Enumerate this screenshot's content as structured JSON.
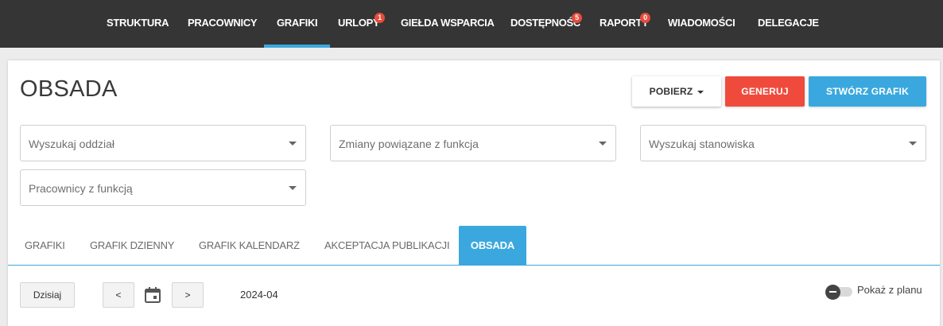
{
  "nav": {
    "items": [
      {
        "label": "STRUKTURA"
      },
      {
        "label": "PRACOWNICY"
      },
      {
        "label": "GRAFIKI",
        "active": true
      },
      {
        "label": "URLOPY",
        "badge": "1"
      },
      {
        "label": "GIEŁDA WSPARCIA"
      },
      {
        "label": "DOSTĘPNOŚĆ",
        "badge": "5"
      },
      {
        "label": "RAPORTY",
        "badge": "0"
      },
      {
        "label": "WIADOMOŚCI"
      },
      {
        "label": "DELEGACJE"
      }
    ],
    "active_color": "#3aa8de",
    "badge_color": "#e84b3c"
  },
  "page": {
    "title": "OBSADA"
  },
  "actions": {
    "pobierz": "POBIERZ",
    "generuj": "GENERUJ",
    "stworz": "STWÓRZ GRAFIK"
  },
  "filters": {
    "oddzial_placeholder": "Wyszukaj oddział",
    "zmiany_placeholder": "Zmiany powiązane z funkcja",
    "stanowisko_placeholder": "Wyszukaj stanowiska",
    "pracownicy_placeholder": "Pracownicy z funkcją"
  },
  "tabs": [
    {
      "label": "GRAFIKI"
    },
    {
      "label": "GRAFIK DZIENNY"
    },
    {
      "label": "GRAFIK KALENDARZ"
    },
    {
      "label": "AKCEPTACJA PUBLIKACJI"
    },
    {
      "label": "OBSADA",
      "active": true
    }
  ],
  "toolbar": {
    "today": "Dzisiaj",
    "prev": "<",
    "next": ">",
    "month": "2024-04",
    "toggle_label": "Pokaż z planu"
  },
  "colors": {
    "accent": "#3aa8de",
    "danger": "#ef4a3c",
    "navbar": "#353535"
  }
}
